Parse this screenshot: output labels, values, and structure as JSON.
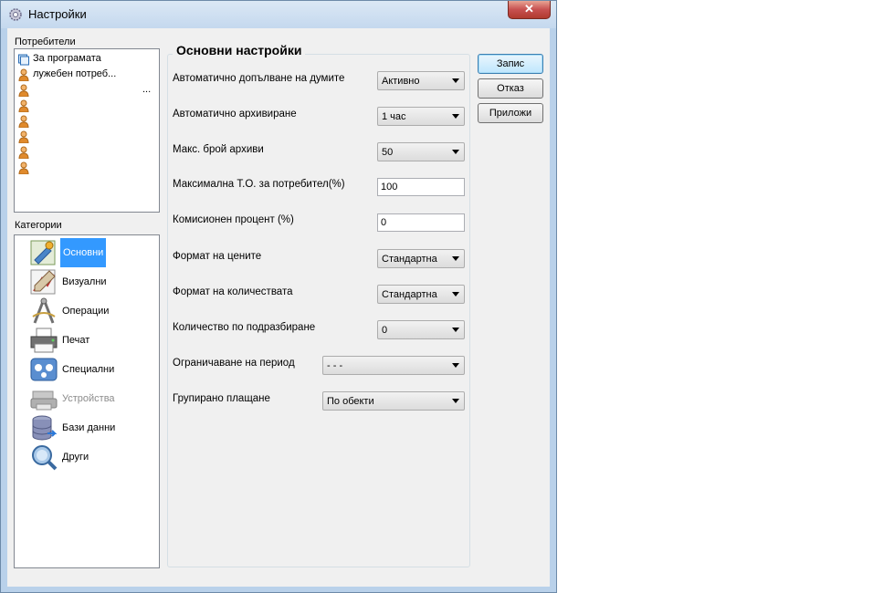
{
  "window": {
    "title": "Настройки",
    "close_label": "✕"
  },
  "users": {
    "label": "Потребители",
    "items": [
      {
        "name": "За програмата",
        "icon": "program-info-icon"
      },
      {
        "name": "лужебен потреб...",
        "icon": "user-icon"
      },
      {
        "name": "...",
        "icon": "user-icon"
      },
      {
        "name": "",
        "icon": "user-icon"
      },
      {
        "name": "",
        "icon": "user-icon"
      },
      {
        "name": "",
        "icon": "user-icon"
      },
      {
        "name": "",
        "icon": "user-icon"
      },
      {
        "name": "",
        "icon": "user-icon"
      }
    ]
  },
  "categories": {
    "label": "Категории",
    "items": [
      {
        "name": "Основни",
        "icon": "basic-settings-icon",
        "selected": true
      },
      {
        "name": "Визуални",
        "icon": "visual-icon"
      },
      {
        "name": "Операции",
        "icon": "operations-icon"
      },
      {
        "name": "Печат",
        "icon": "printer-icon"
      },
      {
        "name": "Специални",
        "icon": "special-icon"
      },
      {
        "name": "Устройства",
        "icon": "devices-icon",
        "disabled": true
      },
      {
        "name": "Бази данни",
        "icon": "database-icon"
      },
      {
        "name": "Други",
        "icon": "other-icon"
      }
    ]
  },
  "settings": {
    "title": "Основни настройки",
    "rows": [
      {
        "label": "Автоматично допълване на думите",
        "type": "combo",
        "value": "Активно"
      },
      {
        "label": "Автоматично архивиране",
        "type": "combo",
        "value": "1 час"
      },
      {
        "label": "Макс. брой архиви",
        "type": "combo",
        "value": "50"
      },
      {
        "label": "Максимална Т.О. за потребител(%)",
        "type": "text",
        "value": "100"
      },
      {
        "label": "Комисионен процент (%)",
        "type": "text",
        "value": "0"
      },
      {
        "label": "Формат на цените",
        "type": "combo",
        "value": "Стандартна"
      },
      {
        "label": "Формат на количествата",
        "type": "combo",
        "value": "Стандартна"
      },
      {
        "label": "Количество по подразбиране",
        "type": "combo",
        "value": "0"
      },
      {
        "label": "Ограничаване на период",
        "type": "combo",
        "value": "- - -"
      },
      {
        "label": "Групирано плащане",
        "type": "combo",
        "value": "По обекти"
      }
    ]
  },
  "buttons": {
    "save": "Запис",
    "cancel": "Отказ",
    "apply": "Приложи"
  },
  "colors": {
    "selection": "#3399ff",
    "window_frame": "#b9d1ea",
    "close_button": "#c75050"
  }
}
